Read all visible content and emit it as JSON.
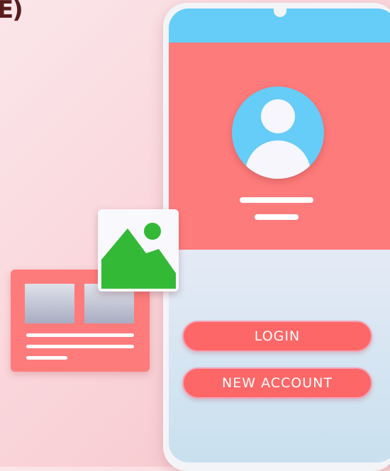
{
  "corner_text": "E)",
  "buttons": {
    "login": "LOGIN",
    "new_account": "NEW ACCOUNT"
  },
  "colors": {
    "coral": "#fe7b7b",
    "button": "#fe6767",
    "sky": "#66ccf8",
    "green": "#34b936"
  },
  "icons": [
    "user-avatar-icon",
    "image-icon"
  ]
}
